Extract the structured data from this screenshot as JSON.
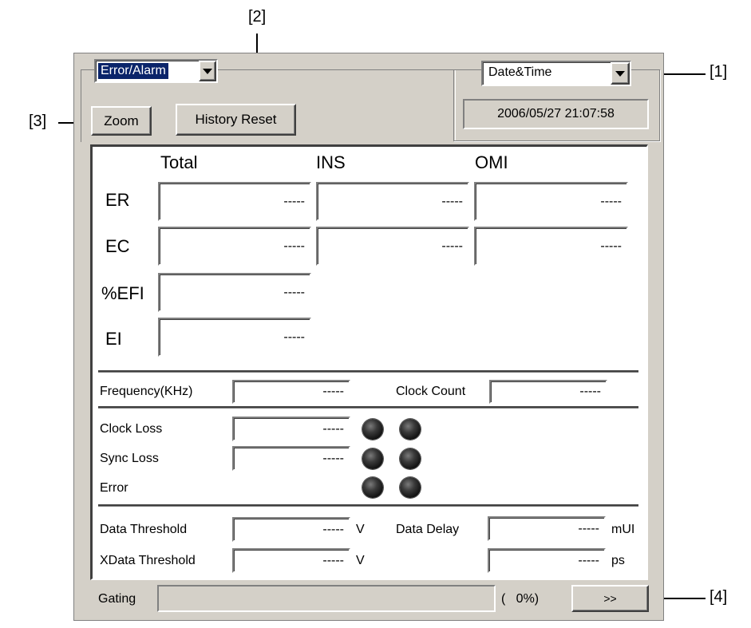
{
  "annotations": {
    "one": "[1]",
    "two": "[2]",
    "three": "[3]",
    "four": "[4]"
  },
  "header": {
    "mode_select": "Error/Alarm",
    "zoom_label": "Zoom",
    "history_reset_label": "History Reset",
    "datetime_select": "Date&Time",
    "datetime_value": "2006/05/27 21:07:58"
  },
  "error_table": {
    "columns": [
      "Total",
      "INS",
      "OMI"
    ],
    "rows": [
      {
        "label": "ER",
        "values": [
          "-----",
          "-----",
          "-----"
        ]
      },
      {
        "label": "EC",
        "values": [
          "-----",
          "-----",
          "-----"
        ]
      },
      {
        "label": "%EFI",
        "values": [
          "-----"
        ]
      },
      {
        "label": "EI",
        "values": [
          "-----"
        ]
      }
    ]
  },
  "frequency": {
    "label": "Frequency(KHz)",
    "value": "-----",
    "clock_count_label": "Clock Count",
    "clock_count_value": "-----"
  },
  "alarms": {
    "clock_loss_label": "Clock Loss",
    "clock_loss_value": "-----",
    "sync_loss_label": "Sync Loss",
    "sync_loss_value": "-----",
    "error_label": "Error"
  },
  "thresholds": {
    "data_threshold_label": "Data Threshold",
    "data_threshold_value": "-----",
    "data_threshold_unit": "V",
    "xdata_threshold_label": "XData Threshold",
    "xdata_threshold_value": "-----",
    "xdata_threshold_unit": "V",
    "data_delay_label": "Data Delay",
    "data_delay_value": "-----",
    "data_delay_unit": "mUI",
    "delay_ps_value": "-----",
    "delay_ps_unit": "ps"
  },
  "gating": {
    "label": "Gating",
    "percent_text": "(   0%)",
    "progress": 0,
    "next_label": ">>"
  }
}
